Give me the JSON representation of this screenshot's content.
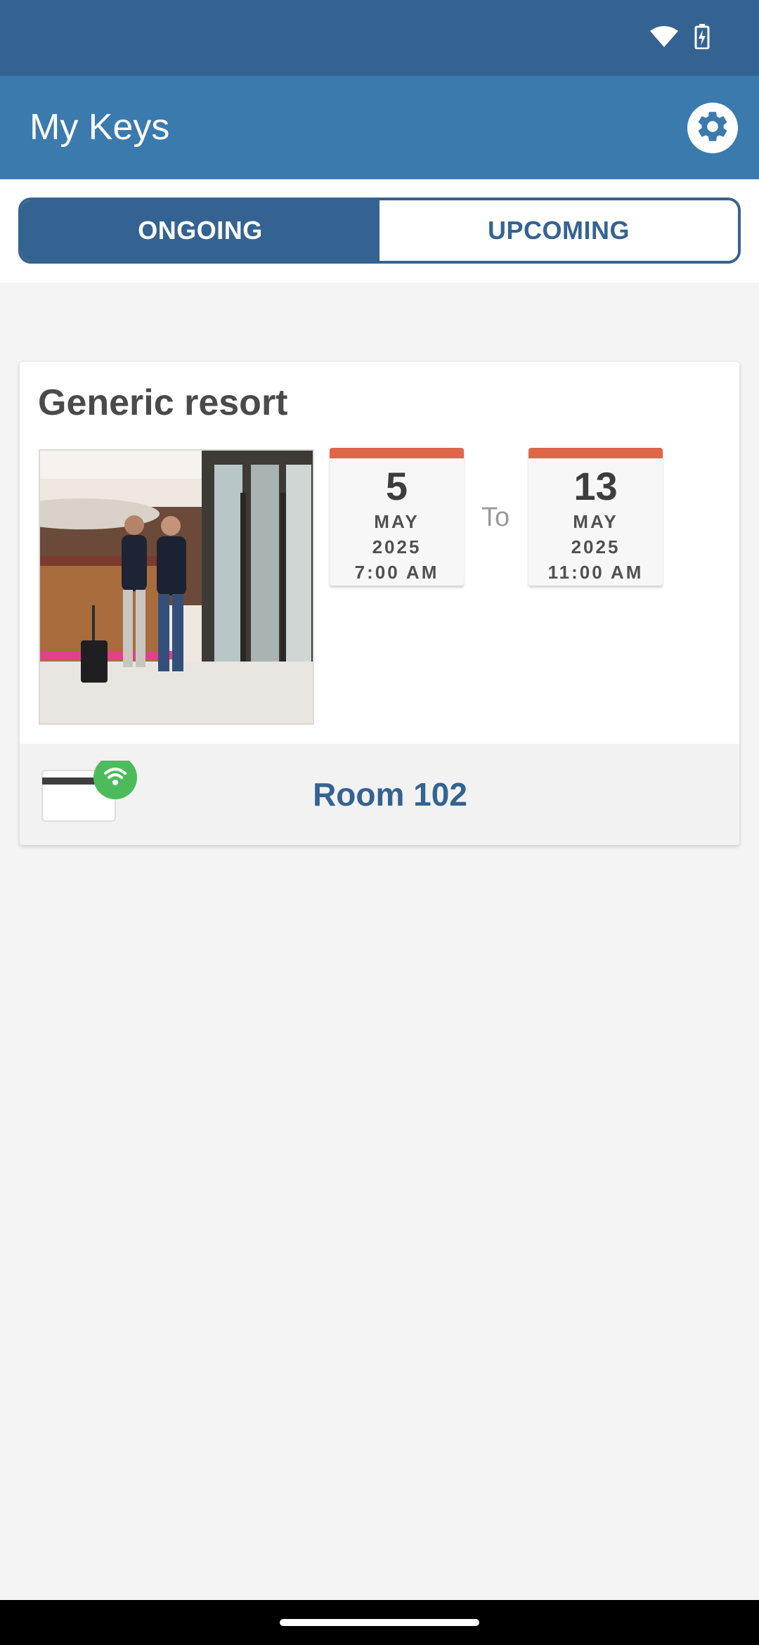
{
  "app_bar": {
    "title": "My Keys",
    "settings_icon": "gear-icon"
  },
  "tabs": [
    {
      "label": "ONGOING",
      "active": true
    },
    {
      "label": "UPCOMING",
      "active": false
    }
  ],
  "reservation": {
    "hotel_name": "Generic resort",
    "start": {
      "day": "5",
      "month": "MAY",
      "year": "2025",
      "time": "7:00 AM"
    },
    "separator": "To",
    "end": {
      "day": "13",
      "month": "MAY",
      "year": "2025",
      "time": "11:00 AM"
    },
    "room": "Room 102"
  },
  "colors": {
    "status_bar": "#346391",
    "app_bar": "#3b7aad",
    "accent": "#346391",
    "calendar_top": "#e0664a",
    "nfc_green": "#4cbb5c"
  }
}
